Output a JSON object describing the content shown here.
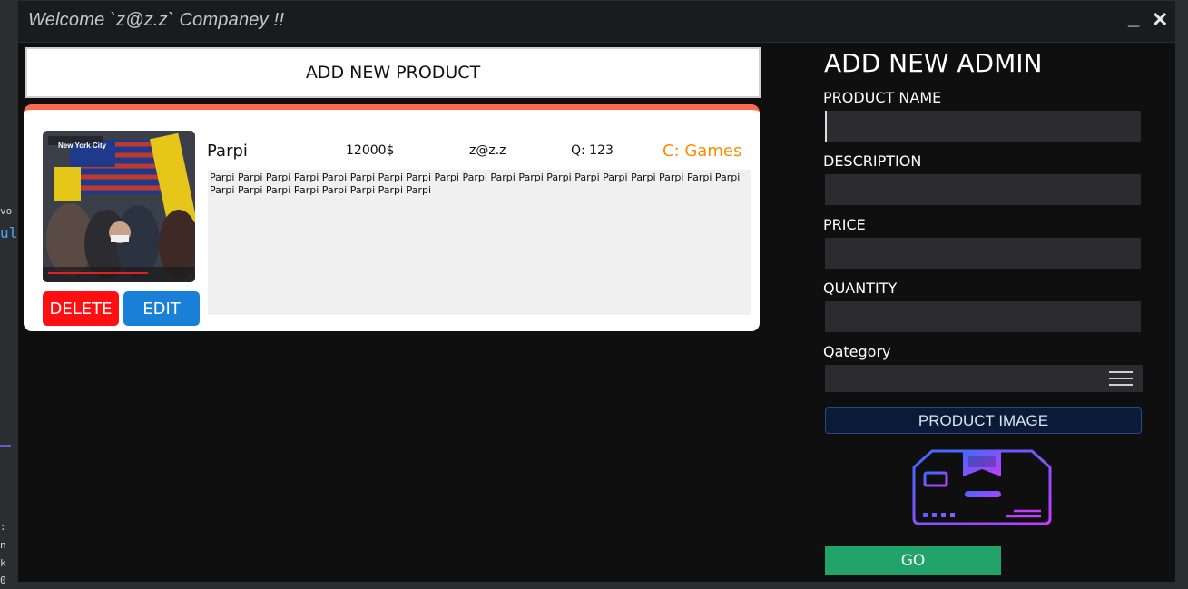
{
  "window": {
    "title": "Welcome `z@z.z` Companey !!",
    "minimize_label": "_",
    "close_label": "✕"
  },
  "background": {
    "left_fragments": [
      "vo",
      "ul",
      ":",
      "n",
      "k",
      "0"
    ]
  },
  "toolbar": {
    "add_product_label": "ADD NEW PRODUCT"
  },
  "product": {
    "name": "Parpi",
    "price": "12000$",
    "owner": "z@z.z",
    "quantity": "Q: 123",
    "category": "C: Games",
    "description": "Parpi Parpi Parpi Parpi Parpi Parpi Parpi Parpi Parpi Parpi Parpi Parpi Parpi Parpi Parpi Parpi Parpi Parpi Parpi Parpi Parpi Parpi Parpi Parpi Parpi Parpi Parpi",
    "image_caption": "New York City",
    "delete_label": "DELETE",
    "edit_label": "EDIT"
  },
  "admin_form": {
    "title": "ADD NEW ADMIN",
    "product_name_label": "PRODUCT NAME",
    "product_name_value": "",
    "description_label": "DESCRIPTION",
    "description_value": "",
    "price_label": "PRICE",
    "price_value": "",
    "quantity_label": "QUANTITY",
    "quantity_value": "",
    "category_label": "Qategory",
    "category_value": "",
    "product_image_label": "PRODUCT IMAGE",
    "go_label": "GO"
  },
  "colors": {
    "card_accent": "#ff6a4d",
    "delete": "#ff0f12",
    "edit": "#1a7fd6",
    "category": "#ff8c00",
    "go": "#21a36a"
  }
}
